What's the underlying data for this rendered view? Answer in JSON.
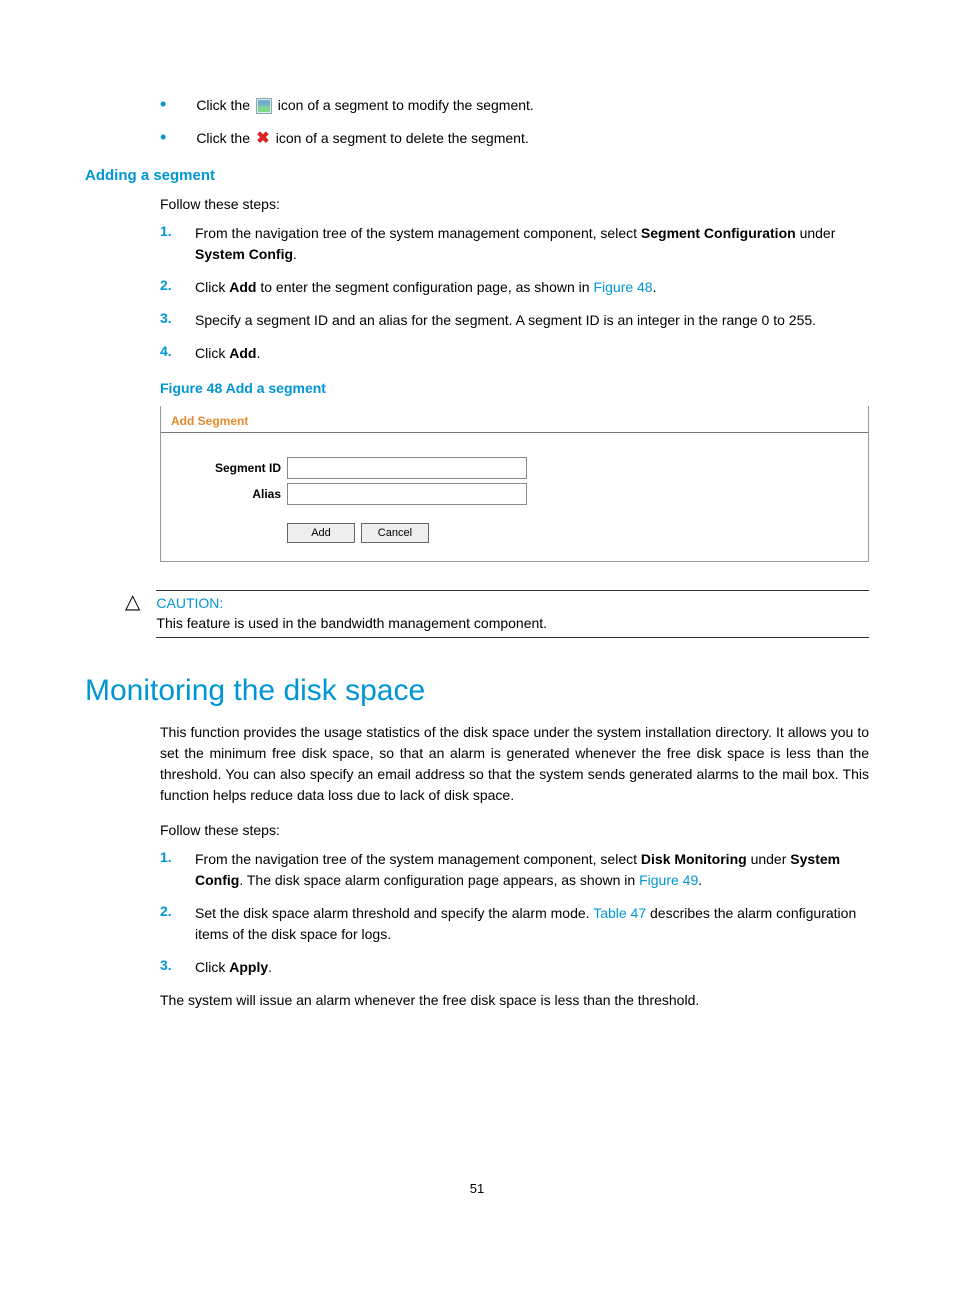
{
  "bullets": {
    "modify_pre": "Click the ",
    "modify_post": " icon of a segment to modify the segment.",
    "delete_pre": "Click the ",
    "delete_post": " icon of a segment to delete the segment."
  },
  "adding_segment": {
    "heading": "Adding a segment",
    "intro": "Follow these steps:",
    "steps": [
      {
        "n": "1.",
        "pre": "From the navigation tree of the system management component, select ",
        "b1": "Segment Configuration",
        "mid": " under ",
        "b2": "System Config",
        "post": "."
      },
      {
        "n": "2.",
        "pre": "Click ",
        "b1": "Add",
        "mid": " to enter the segment configuration page, as shown in ",
        "link": "Figure 48",
        "post": "."
      },
      {
        "n": "3.",
        "text": "Specify a segment ID and an alias for the segment. A segment ID is an integer in the range 0 to 255."
      },
      {
        "n": "4.",
        "pre": "Click ",
        "b1": "Add",
        "post": "."
      }
    ]
  },
  "figure": {
    "caption": "Figure 48 Add a segment",
    "title": "Add Segment",
    "label_segment_id": "Segment ID",
    "label_alias": "Alias",
    "btn_add": "Add",
    "btn_cancel": "Cancel"
  },
  "caution": {
    "label": "CAUTION:",
    "text": "This feature is used in the bandwidth management component."
  },
  "monitoring": {
    "heading": "Monitoring the disk space",
    "para": "This function provides the usage statistics of the disk space under the system installation directory. It allows you to set the minimum free disk space, so that an alarm is generated whenever the free disk space is less than the threshold. You can also specify an email address so that the system sends generated alarms to the mail box. This function helps reduce data loss due to lack of disk space.",
    "intro": "Follow these steps:",
    "steps": [
      {
        "n": "1.",
        "pre": "From the navigation tree of the system management component, select ",
        "b1": "Disk Monitoring",
        "mid": " under ",
        "b2": "System Config",
        "post2": ". The disk space alarm configuration page appears, as shown in ",
        "link": "Figure 49",
        "post": "."
      },
      {
        "n": "2.",
        "pre": "Set the disk space alarm threshold and specify the alarm mode. ",
        "link": "Table 47",
        "post": " describes the alarm configuration items of the disk space for logs."
      },
      {
        "n": "3.",
        "pre": "Click ",
        "b1": "Apply",
        "post": "."
      }
    ],
    "closing": "The system will issue an alarm whenever the free disk space is less than the threshold."
  },
  "page_number": "51"
}
